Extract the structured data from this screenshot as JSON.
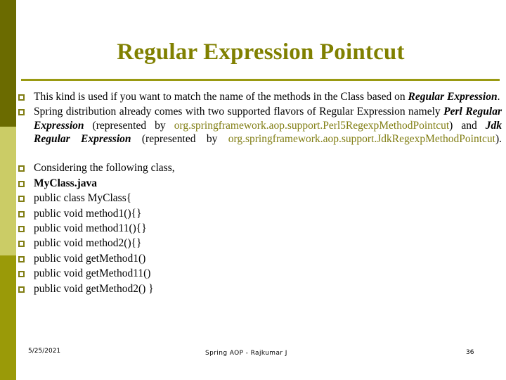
{
  "slide": {
    "title": "Regular Expression Pointcut",
    "accent_color": "#807d12",
    "title_color": "#808000",
    "rule_color": "#9a9a12",
    "sidebar": {
      "top_color": "#6b6b00",
      "mid_color": "#cbcc66",
      "bottom_color": "#9a9a08"
    }
  },
  "bullets": {
    "p1": {
      "lead": "This kind is used if you want to match the name of the methods in the Class based on ",
      "emph": "Regular Expression",
      "tail": "."
    },
    "p2": {
      "s1": "Spring distribution already comes with two supported flavors of Regular Expression namely ",
      "emph1": "Perl Regular Expression",
      "s2": " (represented by ",
      "cls1": "org.springframework.aop.support.Perl5RegexpMethodPointcut",
      "s3": ") and ",
      "emph2": "Jdk Regular Expression",
      "s4": " (represented by ",
      "cls2": "org.springframework.aop.support.JdkRegexpMethodPointcut",
      "s5": ")."
    },
    "p3": "Considering the following class,",
    "p4": "MyClass.java",
    "code": [
      "public class MyClass{",
      "public void method1(){}",
      "public void method11(){}",
      "public void method2(){}",
      "public void getMethod1()",
      "public void getMethod11()",
      "public void getMethod2() }"
    ]
  },
  "footer": {
    "date": "5/25/2021",
    "center": "Spring AOP  -  Rajkumar J",
    "number": "36"
  }
}
